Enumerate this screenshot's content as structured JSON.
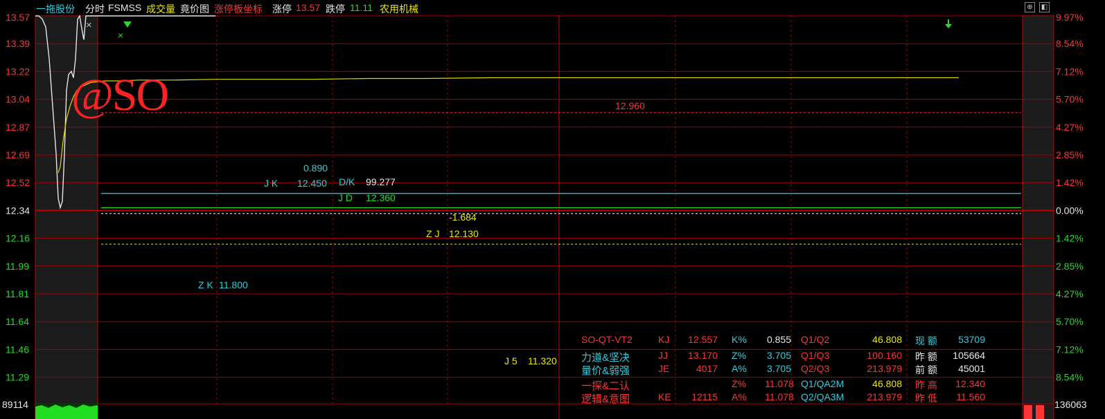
{
  "header": {
    "stock_name": "一拖股份",
    "view_label": "分时",
    "indicator": "FSMSS",
    "volume_label": "成交量",
    "auction_label": "竟价图",
    "limit_axis_label": "涨停板坐标",
    "limit_up_label": "涨停",
    "limit_up_value": "13.57",
    "limit_down_label": "跌停",
    "limit_down_value": "11.11",
    "sector": "农用机械"
  },
  "colors": {
    "up": "#ff3333",
    "down": "#22dd22",
    "cyan": "#33ccdd",
    "yellow": "#e8e810",
    "grid": "#aa0000",
    "price_line": "#e6e6e6",
    "avg_line": "#d9d900"
  },
  "chart_data": {
    "type": "line",
    "price_axis": [
      "13.57",
      "13.39",
      "13.22",
      "13.04",
      "12.87",
      "12.69",
      "12.52",
      "12.34",
      "12.16",
      "11.99",
      "11.81",
      "11.64",
      "11.46",
      "11.29"
    ],
    "pct_axis": [
      "9.97%",
      "8.54%",
      "7.12%",
      "5.70%",
      "4.27%",
      "2.85%",
      "1.42%",
      "0.00%",
      "1.42%",
      "2.85%",
      "4.27%",
      "5.70%",
      "7.12%",
      "8.54%"
    ],
    "volume_left": "89114",
    "volume_right": "136063",
    "ylim": [
      11.11,
      13.57
    ],
    "prev_close": 12.34,
    "series": [
      {
        "x": [
          0,
          5,
          10,
          15,
          20,
          25,
          30,
          33,
          36,
          39,
          42,
          45,
          48,
          52,
          55,
          58,
          61,
          64,
          67,
          70,
          73,
          76,
          80,
          85,
          90,
          100,
          120,
          150,
          200,
          260
        ],
        "values": [
          13.57,
          13.57,
          13.55,
          13.5,
          13.3,
          13.0,
          12.7,
          12.42,
          12.36,
          12.4,
          12.7,
          13.1,
          13.2,
          13.22,
          13.18,
          13.3,
          13.55,
          13.57,
          13.49,
          13.42,
          13.57,
          13.57,
          13.57,
          13.57,
          13.57,
          13.57,
          13.57,
          13.57,
          13.57,
          13.57
        ]
      },
      {
        "x": [
          33,
          36,
          40,
          45,
          50,
          55,
          60,
          65,
          70,
          75,
          80,
          90,
          100,
          120,
          150,
          200,
          260,
          320,
          400,
          480,
          560,
          660,
          760,
          860,
          960,
          1060,
          1160,
          1260,
          1333
        ],
        "values": [
          12.58,
          12.62,
          12.78,
          12.92,
          13.0,
          13.06,
          13.1,
          13.12,
          13.13,
          13.14,
          13.15,
          13.155,
          13.16,
          13.16,
          13.165,
          13.165,
          13.17,
          13.17,
          13.17,
          13.175,
          13.175,
          13.18,
          13.18,
          13.18,
          13.18,
          13.18,
          13.18,
          13.18,
          13.18
        ]
      }
    ],
    "levels": [
      {
        "label": "12.960",
        "value": 12.96
      },
      {
        "label": "JK 12.450",
        "value": 12.45
      },
      {
        "label": "JD 12.360",
        "value": 12.36
      },
      {
        "label": "ZJ 12.130",
        "value": 12.13
      }
    ]
  },
  "annotations": {
    "watermark": "@SO",
    "close_mark": "×",
    "level_12960": "12.960",
    "jk_top": "0.890",
    "jk_label": "J K",
    "jk_value": "12.450",
    "dk_label": "D/K",
    "dk_value": "99.277",
    "jd_label": "J D",
    "jd_value": "12.360",
    "neg_value": "-1.684",
    "zj_label": "Z J",
    "zj_value": "12.130",
    "zk_label": "Z K",
    "zk_value": "11.800",
    "j5_label": "J 5",
    "j5_value": "11.320"
  },
  "panel": {
    "rows": [
      [
        "SO-QT-VT2",
        "KJ",
        "12.557",
        "K%",
        "0.855",
        "Q1/Q2",
        "46.808",
        "现 额",
        "53709"
      ],
      [
        "力道&坚决",
        "JJ",
        "13.170",
        "Z%",
        "3.705",
        "Q1/Q3",
        "100.160",
        "昨 额",
        "105664"
      ],
      [
        "量价&弱强",
        "JE",
        "4017",
        "A%",
        "3.705",
        "Q2/Q3",
        "213.979",
        "前 额",
        "45001"
      ],
      [
        "一探&二认",
        "",
        "",
        "Z%",
        "11.078",
        "Q1/QA2M",
        "46.808",
        "昨 高",
        "12.340"
      ],
      [
        "逻辑&意图",
        "KE",
        "12115",
        "A%",
        "11.078",
        "Q2/QA3M",
        "213.979",
        "昨 低",
        "11.560"
      ]
    ]
  }
}
